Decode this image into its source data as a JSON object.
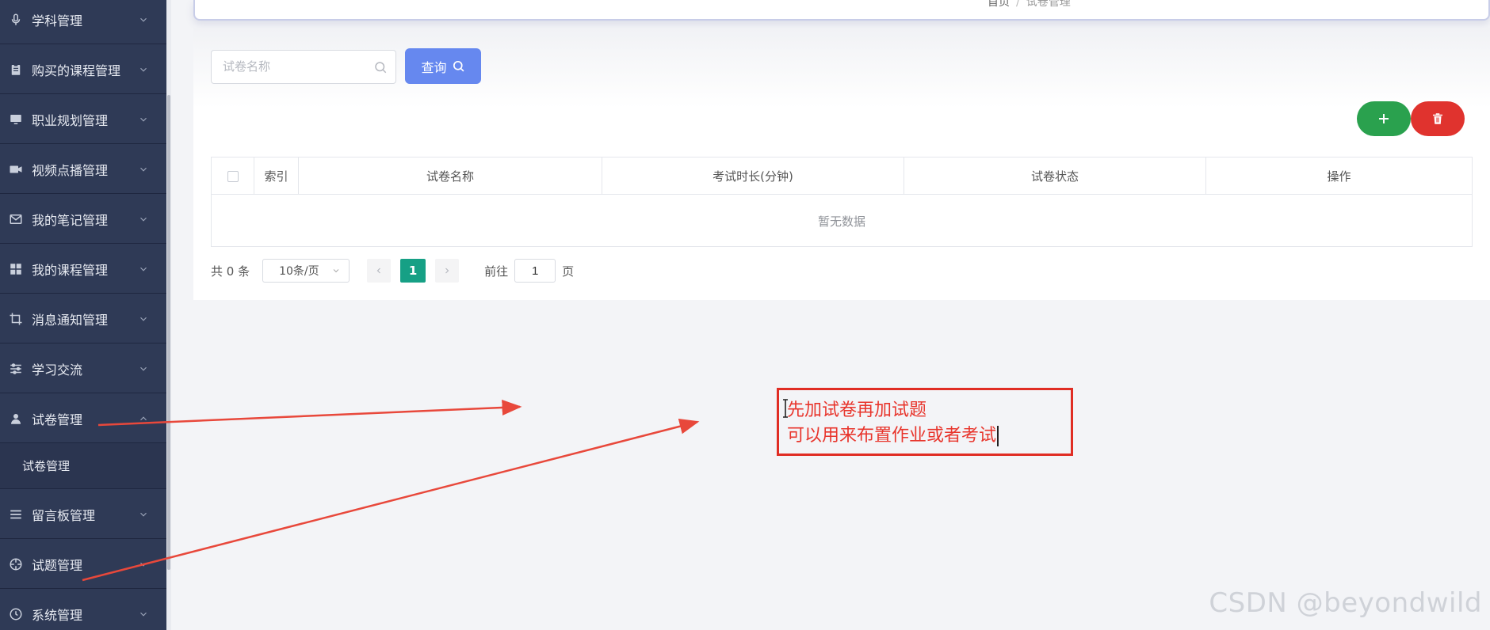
{
  "sidebar": {
    "items": [
      {
        "label": "学科管理",
        "icon": "microphone-icon"
      },
      {
        "label": "购买的课程管理",
        "icon": "clipboard-icon"
      },
      {
        "label": "职业规划管理",
        "icon": "monitor-icon"
      },
      {
        "label": "视频点播管理",
        "icon": "video-camera-icon"
      },
      {
        "label": "我的笔记管理",
        "icon": "envelope-icon"
      },
      {
        "label": "我的课程管理",
        "icon": "grid-icon"
      },
      {
        "label": "消息通知管理",
        "icon": "crop-icon"
      },
      {
        "label": "学习交流",
        "icon": "sliders-icon"
      },
      {
        "label": "试卷管理",
        "icon": "user-icon",
        "expanded": true
      },
      {
        "label": "留言板管理",
        "icon": "list-icon"
      },
      {
        "label": "试题管理",
        "icon": "aperture-icon"
      },
      {
        "label": "系统管理",
        "icon": "clock-icon"
      }
    ],
    "subitem": "试卷管理"
  },
  "breadcrumb": {
    "home": "首页",
    "separator": "/",
    "current": "试卷管理"
  },
  "search": {
    "placeholder": "试卷名称",
    "value": "",
    "button_label": "查询"
  },
  "toolbar": {
    "add_icon": "plus-icon",
    "delete_icon": "trash-icon",
    "add_color": "#2aa14e",
    "delete_color": "#e0332e"
  },
  "table": {
    "columns": [
      "索引",
      "试卷名称",
      "考试时长(分钟)",
      "试卷状态",
      "操作"
    ],
    "empty_text": "暂无数据"
  },
  "pagination": {
    "total_text": "共 0 条",
    "page_size": "10条/页",
    "current_page": "1",
    "goto_label": "前往",
    "goto_value": "1",
    "page_suffix": "页"
  },
  "annotation": {
    "line1": "先加试卷再加试题",
    "line2": "可以用来布置作业或者考试",
    "color": "#e8352c"
  },
  "watermark": "CSDN @beyondwild",
  "colors": {
    "sidebar_bg": "#2f3a56",
    "primary": "#6688ef",
    "page_active": "#16a085"
  }
}
